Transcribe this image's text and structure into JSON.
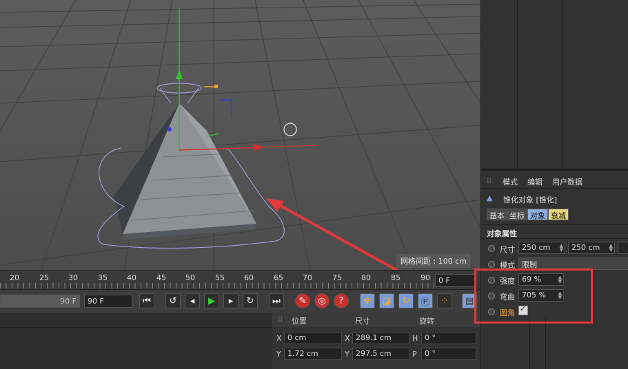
{
  "viewport": {
    "grid_spacing_label": "网格间距 : 100 cm"
  },
  "timeline": {
    "ticks": [
      "20",
      "25",
      "30",
      "35",
      "40",
      "45",
      "50",
      "55",
      "60",
      "65",
      "70",
      "75",
      "80",
      "85",
      "90"
    ],
    "current_frame": "0 F"
  },
  "transport": {
    "end_frame_left": "90 F",
    "end_frame": "90 F"
  },
  "coords": {
    "headers": {
      "position": "位置",
      "size": "尺寸",
      "rotation": "旋转"
    },
    "rows": [
      {
        "axis": "X",
        "pos": "0 cm",
        "size": "289.1 cm",
        "rot_axis": "H",
        "rot": "0 °"
      },
      {
        "axis": "Y",
        "pos": "1.72 cm",
        "size": "297.5 cm",
        "rot_axis": "P",
        "rot": "0 °"
      }
    ]
  },
  "attributes": {
    "menu": [
      "模式",
      "编辑",
      "用户数据"
    ],
    "object_title": "锥化对象 [锥化]",
    "tabs": [
      "基本",
      "坐标",
      "对象",
      "衰减"
    ],
    "section": "对象属性",
    "size_label": "尺寸",
    "size_values": [
      "250 cm",
      "250 cm"
    ],
    "mode_label": "模式",
    "mode_value": "限制",
    "strength_label": "强度",
    "strength_value": "69 %",
    "curvature_label": "弯曲",
    "curvature_value": "705 %",
    "fillet_label": "圆角"
  },
  "colors": {
    "annotation": "#e03a3a",
    "active_tab": "#8fb0e0",
    "falloff_tab": "#e8d77a"
  }
}
